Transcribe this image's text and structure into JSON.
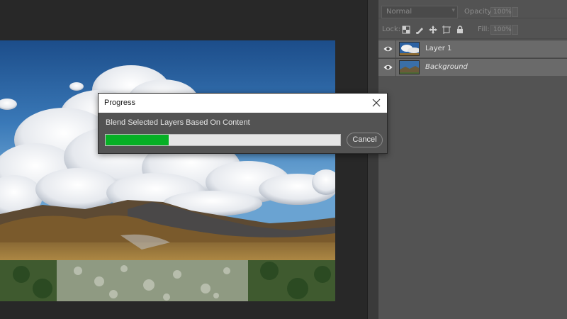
{
  "layers_panel": {
    "blend_mode": "Normal",
    "opacity_label": "Opacity:",
    "opacity_value": "100%",
    "lock_label": "Lock:",
    "fill_label": "Fill:",
    "fill_value": "100%",
    "lock_icons": [
      "lock-transparent-pixels-icon",
      "lock-image-pixels-icon",
      "lock-position-icon",
      "artboard-nesting-icon",
      "lock-all-icon"
    ],
    "layers": [
      {
        "name": "Layer 1",
        "visible": true,
        "selected": true,
        "thumbnail": "cloud-sky-landscape-thumbnail"
      },
      {
        "name": "Background",
        "visible": true,
        "selected": false,
        "thumbnail": "mountain-landscape-thumbnail"
      }
    ]
  },
  "dialog": {
    "title": "Progress",
    "message": "Blend Selected Layers Based On Content",
    "progress_fraction": 0.27,
    "progress_color": "#06b025",
    "cancel_label": "Cancel",
    "close_icon": "close-icon"
  },
  "colors": {
    "workspace_bg": "#282828",
    "panel_bg": "#535353",
    "selected_layer_bg": "#6a6a6a",
    "dialog_titlebar": "#ffffff"
  }
}
